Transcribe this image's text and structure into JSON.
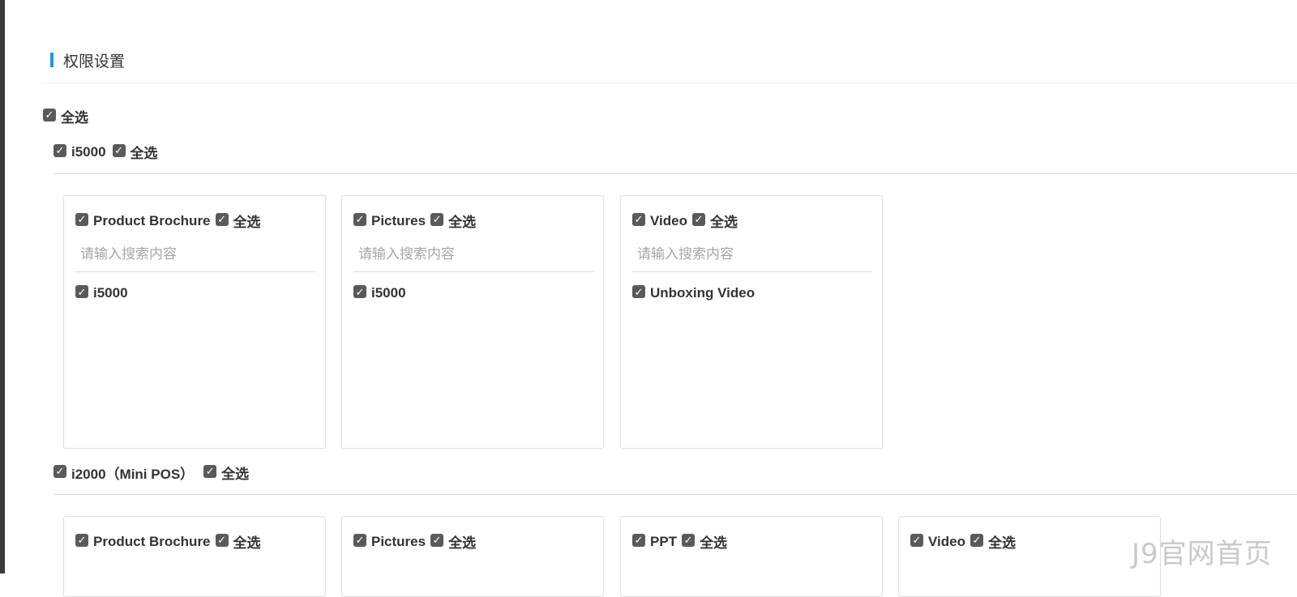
{
  "section": {
    "title": "权限设置"
  },
  "select_all_label": "全选",
  "groups": [
    {
      "name": "i5000",
      "select_all": "全选",
      "cards": [
        {
          "title": "Product Brochure",
          "select_all": "全选",
          "search_placeholder": "请输入搜索内容",
          "items": [
            "i5000"
          ]
        },
        {
          "title": "Pictures",
          "select_all": "全选",
          "search_placeholder": "请输入搜索内容",
          "items": [
            "i5000"
          ]
        },
        {
          "title": "Video",
          "select_all": "全选",
          "search_placeholder": "请输入搜索内容",
          "items": [
            "Unboxing Video"
          ]
        }
      ]
    },
    {
      "name": "i2000（Mini POS）",
      "select_all": "全选",
      "cards": [
        {
          "title": "Product Brochure",
          "select_all": "全选"
        },
        {
          "title": "Pictures",
          "select_all": "全选"
        },
        {
          "title": "PPT",
          "select_all": "全选"
        },
        {
          "title": "Video",
          "select_all": "全选"
        }
      ]
    }
  ],
  "watermark": "J9官网首页",
  "colors": {
    "accent": "#1a9bd7",
    "checkbox": "#5a5a5a",
    "border": "#dddddd"
  },
  "icons": {
    "checkbox": "check-icon"
  }
}
